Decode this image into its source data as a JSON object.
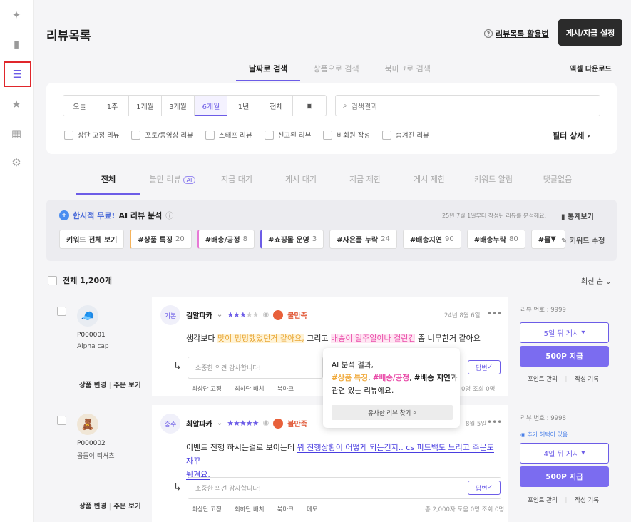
{
  "sidebar": {
    "icons": [
      "sparkle-icon",
      "bar-chart-icon",
      "list-icon",
      "star-icon",
      "dashboard-icon",
      "gear-icon"
    ]
  },
  "header": {
    "title": "리뷰목록",
    "guide": "리뷰목록 활용법",
    "settle_button": "게시/지급 설정",
    "excel": "엑셀 다운로드"
  },
  "search_tabs": [
    "날짜로 검색",
    "상품으로 검색",
    "북마크로 검색"
  ],
  "periods": [
    "오늘",
    "1주",
    "1개월",
    "3개월",
    "6개월",
    "1년",
    "전체"
  ],
  "search": {
    "placeholder": "검색결과"
  },
  "filters": {
    "checks": [
      "상단 고정 리뷰",
      "포토/동영상 리뷰",
      "스태프 리뷰",
      "신고된 리뷰",
      "비회원 작성",
      "숨겨진 리뷰"
    ],
    "detail": "필터 상세"
  },
  "status_tabs": [
    "전체",
    "불만 리뷰",
    "지급 대기",
    "게시 대기",
    "지급 제한",
    "게시 제한",
    "키워드 알림",
    "댓글없음"
  ],
  "ai_badge": "AI",
  "ai_panel": {
    "free": "한시적 무료!",
    "title": "AI 리뷰 분석",
    "note": "25년 7월 1일부터 작성된 리뷰를 분석해요.",
    "stats": "통계보기",
    "keywords": [
      {
        "label": "키워드 전체 보기",
        "count": ""
      },
      {
        "label": "#상품 특징",
        "count": "20"
      },
      {
        "label": "#배송/공정",
        "count": "8"
      },
      {
        "label": "#쇼핑몰 운영",
        "count": "3"
      },
      {
        "label": "#사은품 누락",
        "count": "24"
      },
      {
        "label": "#배송지연",
        "count": "90"
      },
      {
        "label": "#배송누락",
        "count": "80"
      },
      {
        "label": "#물",
        "count": ""
      }
    ],
    "edit": "키워드 수정"
  },
  "list": {
    "total": "전체 1,200개",
    "sort": "최신 순"
  },
  "reviews": [
    {
      "pid": "P000001",
      "pname": "Alpha cap",
      "links": [
        "상품 변경",
        "주문 보기"
      ],
      "tag": "기본",
      "author": "김알파카",
      "stars": "★★★",
      "stars_off": "★★",
      "mood": "불만족",
      "date": "24년 8월 6일",
      "text_pre": "생각보다 ",
      "hl1": "맛이 밍밍했었던거 같아요,",
      "text_mid": " 그리고 ",
      "hl2": "배송이 일주일이나 걸린건",
      "text_post": " 좀 너무한거 같아요",
      "reply_placeholder": "소중한 의견 감사합니다!",
      "reply_btn": "답변",
      "actions": [
        "최상단 고정",
        "최하단 배치",
        "북마크"
      ],
      "stat": "0명 조회 0명",
      "rno": "리뷰 번호 : 9999",
      "post": "5일 뒤 게시",
      "pay": "500P 지급",
      "mini": [
        "포인트 관리",
        "작성 기록"
      ]
    },
    {
      "pid": "P000002",
      "pname": "곰돌이 티셔츠",
      "links": [
        "상품 변경",
        "주문 보기"
      ],
      "tag": "중수",
      "author": "최알파카",
      "stars": "★★★★★",
      "mood": "불만족",
      "date": "8월 5일",
      "text_pre": "이벤트 진행 하시는걸로 보이는데 ",
      "hl1": "뭐 진행상황이 어떻게 되는건지.. cs 피드백도 느리고 주문도 자꾸",
      "text_line2": "튕겨요.",
      "reply_placeholder": "소중한 의견 감사합니다!",
      "reply_btn": "답변",
      "actions": [
        "최상단 고정",
        "최하단 배치",
        "북마크",
        "메모"
      ],
      "stat": "총 2,000자 도움 0명 조회 0명",
      "rno": "리뷰 번호 : 9998",
      "boost": "추가 혜택이 있음",
      "post": "4일 뒤 게시",
      "pay": "500P 지급",
      "mini": [
        "포인트 관리",
        "작성 기록"
      ]
    }
  ],
  "tooltip": {
    "line1": "AI 분석 결과,",
    "kw1": "#상품 특징",
    "kw2": "#배송/공정",
    "kw3": "#배송 지연",
    "suffix": "과",
    "line3": "관련 있는 리뷰에요.",
    "button": "유사한 리뷰 찾기"
  }
}
